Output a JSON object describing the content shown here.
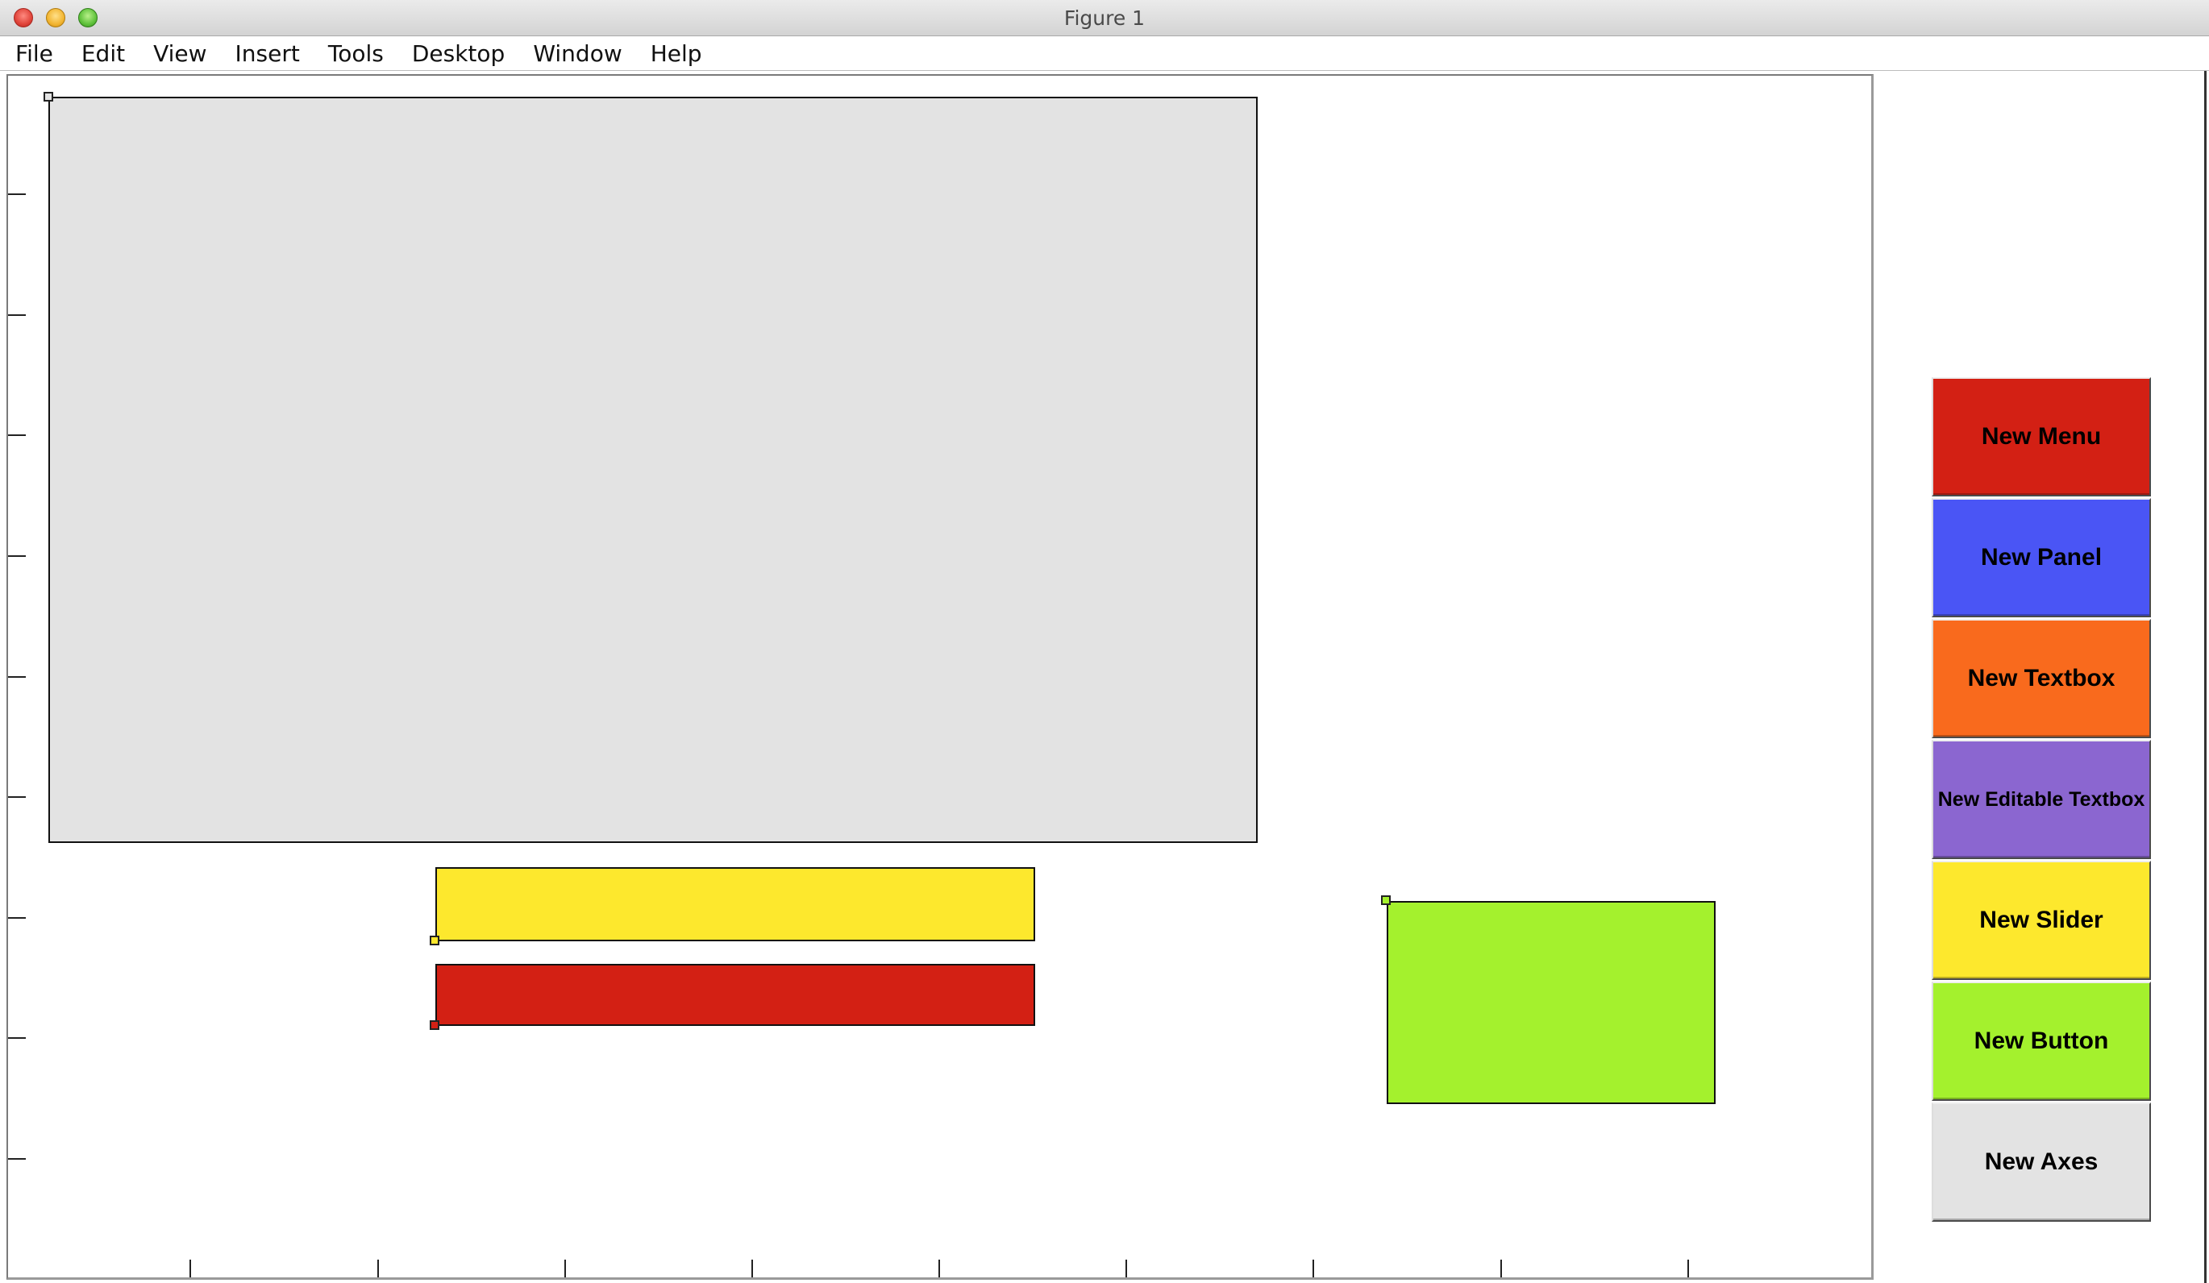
{
  "window": {
    "title": "Figure 1"
  },
  "menubar": {
    "items": [
      "File",
      "Edit",
      "View",
      "Insert",
      "Tools",
      "Desktop",
      "Window",
      "Help"
    ]
  },
  "buttons": [
    {
      "label": "New Menu",
      "color": "#d32014"
    },
    {
      "label": "New Panel",
      "color": "#4a55f5"
    },
    {
      "label": "New Textbox",
      "color": "#f96a1d"
    },
    {
      "label": "New Editable Textbox",
      "color": "#8b66d0"
    },
    {
      "label": "New Slider",
      "color": "#fde82d"
    },
    {
      "label": "New Button",
      "color": "#a4f12d"
    },
    {
      "label": "New Axes",
      "color": "#e3e3e3"
    }
  ],
  "canvas_objects": [
    {
      "kind": "axes",
      "color": "#e3e3e3"
    },
    {
      "kind": "slider",
      "color": "#fde82d"
    },
    {
      "kind": "menu",
      "color": "#d32014"
    },
    {
      "kind": "button",
      "color": "#a4f12d"
    }
  ]
}
